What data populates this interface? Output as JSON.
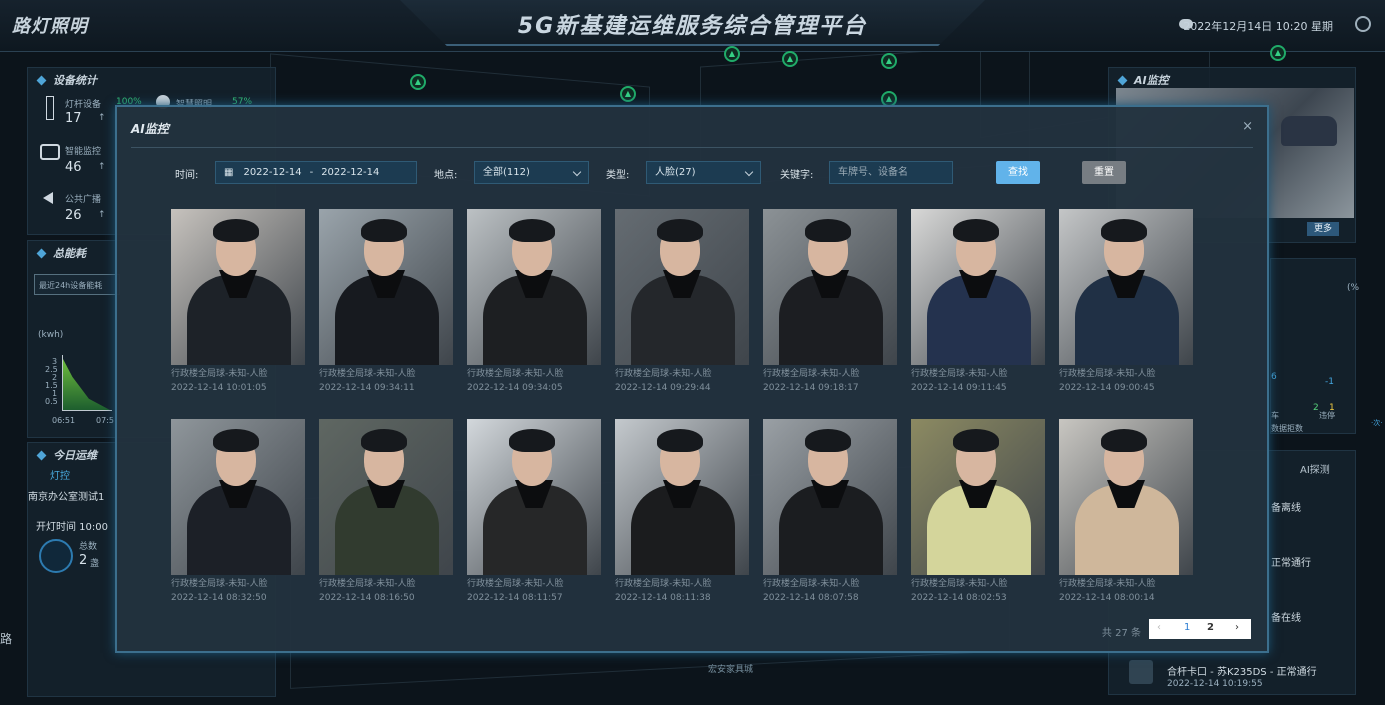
{
  "header": {
    "brand": "路灯照明",
    "platform_title": "5G新基建运维服务综合管理平台",
    "datetime": "2022年12月14日 10:20 星期"
  },
  "left": {
    "device_stats": {
      "title": "设备统计",
      "rows": [
        {
          "label": "灯杆设备",
          "rate": "100%",
          "count": "17",
          "arrow": "↑",
          "extra_label": "智慧照明",
          "extra_rate": "57%"
        },
        {
          "label": "智能监控",
          "count": "46",
          "arrow": "↑"
        },
        {
          "label": "公共广播",
          "count": "26",
          "arrow": "↑"
        }
      ]
    },
    "energy": {
      "title": "总能耗",
      "dropdown": "最近24h设备能耗",
      "unit": "(kwh)",
      "y_ticks": [
        "3",
        "2.5",
        "2",
        "1.5",
        "1",
        "0.5"
      ],
      "x_ticks": [
        "06:51",
        "07:5"
      ]
    },
    "today_ops": {
      "title": "今日运维",
      "tab": "灯控",
      "location": "南京办公室测试1",
      "open_time": "开灯时间 10:00",
      "total_label": "总数",
      "total_value": "2",
      "unit": "盏"
    },
    "side_text": "路"
  },
  "right": {
    "ai_monitor": {
      "title": "AI监控",
      "more": "更多"
    },
    "chart_values": {
      "pct": "(%",
      "v1": "-1",
      "v2": "2",
      "v3": "1",
      "v4": "6",
      "label_a": "车",
      "label_b": "违停",
      "label_c": "数据拒数",
      "far_right": "·次·"
    },
    "probe": {
      "title": "AI探测",
      "items": [
        "备离线",
        "正常通行",
        "备在线"
      ],
      "last_item": "合杆卡口 - 苏K235DS - 正常通行",
      "last_time": "2022-12-14 10:19:55"
    }
  },
  "map": {
    "bottom_label": "宏安家具城"
  },
  "modal": {
    "title": "AI监控",
    "close": "×",
    "filters": {
      "time_label": "时间:",
      "date_from": "2022-12-14",
      "date_sep": "-",
      "date_to": "2022-12-14",
      "place_label": "地点:",
      "place_value": "全部(112)",
      "type_label": "类型:",
      "type_value": "人脸(27)",
      "keyword_label": "关键字:",
      "keyword_placeholder": "车牌号、设备名",
      "search": "查找",
      "reset": "重置"
    },
    "cards": [
      {
        "caption": "行政楼全局球-未知-人脸",
        "time": "2022-12-14 10:01:05"
      },
      {
        "caption": "行政楼全局球-未知-人脸",
        "time": "2022-12-14 09:34:11"
      },
      {
        "caption": "行政楼全局球-未知-人脸",
        "time": "2022-12-14 09:34:05"
      },
      {
        "caption": "行政楼全局球-未知-人脸",
        "time": "2022-12-14 09:29:44"
      },
      {
        "caption": "行政楼全局球-未知-人脸",
        "time": "2022-12-14 09:18:17"
      },
      {
        "caption": "行政楼全局球-未知-人脸",
        "time": "2022-12-14 09:11:45"
      },
      {
        "caption": "行政楼全局球-未知-人脸",
        "time": "2022-12-14 09:00:45"
      },
      {
        "caption": "行政楼全局球-未知-人脸",
        "time": "2022-12-14 08:32:50"
      },
      {
        "caption": "行政楼全局球-未知-人脸",
        "time": "2022-12-14 08:16:50"
      },
      {
        "caption": "行政楼全局球-未知-人脸",
        "time": "2022-12-14 08:11:57"
      },
      {
        "caption": "行政楼全局球-未知-人脸",
        "time": "2022-12-14 08:11:38"
      },
      {
        "caption": "行政楼全局球-未知-人脸",
        "time": "2022-12-14 08:07:58"
      },
      {
        "caption": "行政楼全局球-未知-人脸",
        "time": "2022-12-14 08:02:53"
      },
      {
        "caption": "行政楼全局球-未知-人脸",
        "time": "2022-12-14 08:00:14"
      }
    ],
    "pagination": {
      "total": "共 27 条",
      "prev": "‹",
      "page1": "1",
      "page2": "2",
      "next": "›"
    }
  }
}
